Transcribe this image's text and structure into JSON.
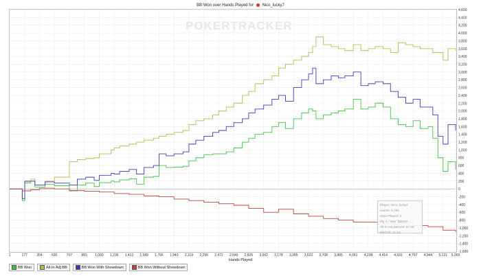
{
  "title": {
    "text": "BB Won over Hands Played for",
    "player": "Nico_lucky7"
  },
  "watermark": "POKERTRACKER",
  "tooltip": {
    "player": "Player: Nico_lucky7",
    "hands": "Hands: 5,269",
    "days": "Days Played: 2",
    "stddev": "Ply C / Dev: $29.57",
    "allin": "All-In Adj BB/100: 67.36",
    "bb100": "BB/100: 11.22"
  },
  "chart_data": {
    "type": "line",
    "title": "BB Won over Hands Played for Nico_lucky7",
    "xlabel": "Hands Played",
    "ylabel": "",
    "x_ticks": [
      "1",
      "177",
      "354",
      "530",
      "707",
      "883",
      "1,060",
      "1,236",
      "1,413",
      "1,589",
      "1,766",
      "1,943",
      "2,119",
      "2,296",
      "2,472",
      "2,649",
      "2,825",
      "3,002",
      "3,178",
      "3,355",
      "3,532",
      "3,708",
      "3,885",
      "4,061",
      "4,238",
      "4,414",
      "4,591",
      "4,767",
      "4,944",
      "5,121",
      "5,269"
    ],
    "xlim": [
      1,
      5269
    ],
    "y_ticks": [
      "4,600",
      "4,400",
      "4,200",
      "4,000",
      "3,800",
      "3,600",
      "3,400",
      "3,200",
      "3,000",
      "2,800",
      "2,600",
      "2,400",
      "2,200",
      "2,000",
      "1,800",
      "1,600",
      "1,400",
      "1,200",
      "1,000",
      "800",
      "600",
      "400",
      "200",
      "0",
      "-200",
      "-400",
      "-600",
      "-800",
      "-1,000",
      "-1,200",
      "-1,400",
      "-1,600"
    ],
    "ylim": [
      -1600,
      4600
    ],
    "grid": true,
    "legend_position": "bottom-left",
    "series": [
      {
        "name": "BB Won",
        "color": "#3fbf3f",
        "x": [
          1,
          150,
          180,
          250,
          300,
          420,
          530,
          707,
          800,
          900,
          1000,
          1060,
          1200,
          1236,
          1300,
          1413,
          1500,
          1589,
          1700,
          1766,
          1850,
          1943,
          2050,
          2119,
          2200,
          2296,
          2400,
          2472,
          2560,
          2649,
          2750,
          2825,
          2900,
          3002,
          3100,
          3178,
          3260,
          3355,
          3450,
          3532,
          3580,
          3620,
          3708,
          3800,
          3885,
          3960,
          4061,
          4150,
          4238,
          4320,
          4414,
          4500,
          4591,
          4680,
          4767,
          4850,
          4944,
          5000,
          5060,
          5121,
          5180,
          5269
        ],
        "y": [
          0,
          -300,
          150,
          200,
          50,
          120,
          80,
          -50,
          100,
          150,
          60,
          160,
          200,
          180,
          230,
          260,
          120,
          300,
          320,
          600,
          550,
          560,
          580,
          720,
          800,
          880,
          900,
          900,
          950,
          1050,
          1200,
          1300,
          1400,
          1450,
          1600,
          1700,
          1550,
          1800,
          1950,
          2050,
          2000,
          1800,
          1900,
          1950,
          2000,
          2050,
          2300,
          2050,
          2100,
          2200,
          2100,
          1800,
          1650,
          1600,
          1750,
          1550,
          1600,
          1300,
          800,
          450,
          700,
          500
        ]
      },
      {
        "name": "All-In Adj BB",
        "color": "#b8b84a",
        "x": [
          1,
          150,
          180,
          250,
          300,
          420,
          530,
          707,
          800,
          900,
          1000,
          1060,
          1200,
          1236,
          1300,
          1413,
          1500,
          1589,
          1700,
          1766,
          1850,
          1943,
          2050,
          2119,
          2200,
          2296,
          2400,
          2472,
          2560,
          2649,
          2750,
          2825,
          2900,
          3002,
          3100,
          3178,
          3260,
          3355,
          3450,
          3532,
          3580,
          3620,
          3708,
          3800,
          3885,
          3960,
          4061,
          4150,
          4238,
          4320,
          4414,
          4500,
          4591,
          4680,
          4767,
          4850,
          4944,
          5000,
          5060,
          5121,
          5180,
          5269
        ],
        "y": [
          0,
          -250,
          180,
          250,
          100,
          200,
          300,
          700,
          750,
          780,
          800,
          900,
          1000,
          1050,
          1100,
          1150,
          1200,
          1250,
          1300,
          1350,
          1400,
          1450,
          1500,
          1650,
          1750,
          1800,
          1900,
          2000,
          2100,
          2200,
          2400,
          2500,
          2700,
          2800,
          2900,
          3100,
          3200,
          3300,
          3400,
          3500,
          3650,
          3900,
          3700,
          3650,
          3600,
          3550,
          3700,
          3550,
          3600,
          3650,
          3600,
          3500,
          3750,
          3700,
          3650,
          3600,
          3600,
          3500,
          3500,
          3300,
          3600,
          3550
        ]
      },
      {
        "name": "BB Won With Showdown",
        "color": "#3a3ab8",
        "x": [
          1,
          150,
          180,
          250,
          300,
          420,
          530,
          707,
          800,
          900,
          1000,
          1060,
          1200,
          1236,
          1300,
          1413,
          1500,
          1589,
          1700,
          1766,
          1850,
          1943,
          2050,
          2119,
          2200,
          2296,
          2400,
          2472,
          2560,
          2649,
          2750,
          2825,
          2900,
          3002,
          3100,
          3178,
          3260,
          3355,
          3450,
          3532,
          3580,
          3620,
          3708,
          3800,
          3885,
          3960,
          4061,
          4150,
          4238,
          4320,
          4414,
          4500,
          4591,
          4680,
          4767,
          4850,
          4944,
          5000,
          5060,
          5121,
          5180,
          5269
        ],
        "y": [
          0,
          -250,
          200,
          200,
          100,
          180,
          150,
          100,
          250,
          300,
          220,
          350,
          400,
          380,
          450,
          500,
          380,
          550,
          600,
          900,
          850,
          900,
          950,
          1150,
          1250,
          1350,
          1450,
          1500,
          1600,
          1700,
          1800,
          1950,
          2050,
          2150,
          2300,
          2400,
          2250,
          2600,
          2800,
          2950,
          3100,
          2700,
          2800,
          2900,
          2850,
          2900,
          3000,
          2650,
          2700,
          2750,
          2700,
          2500,
          2350,
          2200,
          2300,
          2100,
          2100,
          1900,
          1350,
          1150,
          1650,
          1500
        ]
      },
      {
        "name": "BB Won Without Showdown",
        "color": "#c04040",
        "x": [
          1,
          150,
          250,
          354,
          530,
          707,
          883,
          1060,
          1236,
          1413,
          1589,
          1766,
          1943,
          2119,
          2296,
          2472,
          2649,
          2825,
          3002,
          3178,
          3355,
          3532,
          3708,
          3885,
          4061,
          4238,
          4414,
          4591,
          4767,
          4944,
          5121,
          5269
        ],
        "y": [
          0,
          -50,
          -20,
          20,
          0,
          -40,
          -60,
          -80,
          -120,
          -140,
          -180,
          -200,
          -260,
          -300,
          -340,
          -380,
          -420,
          -500,
          -600,
          -520,
          -640,
          -700,
          -760,
          -800,
          -850,
          -850,
          -900,
          -850,
          -940,
          -970,
          -1060,
          -1100
        ]
      }
    ]
  }
}
